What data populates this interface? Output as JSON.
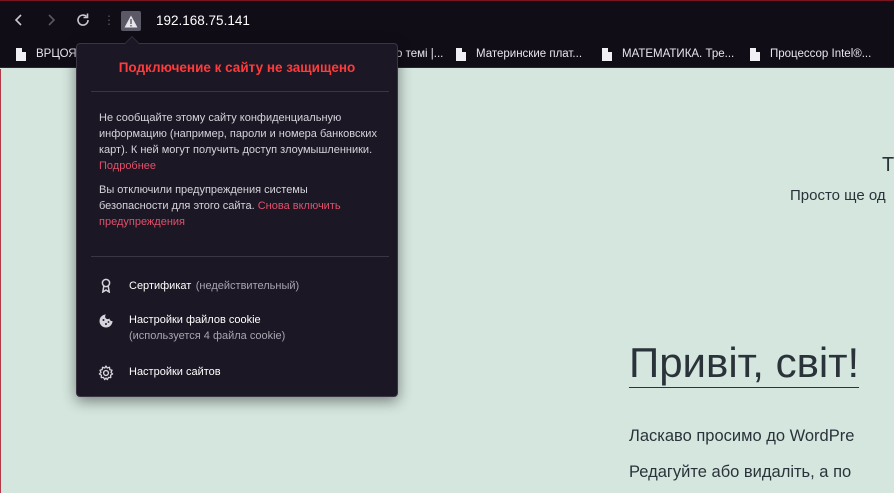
{
  "browser": {
    "address": "192.168.75.141",
    "bookmarks": [
      {
        "label": "ВРЦОЯ"
      },
      {
        "label": "о темі |..."
      },
      {
        "label": "Материнские плат..."
      },
      {
        "label": "МАТЕМАТИКА. Тре..."
      },
      {
        "label": "Процессор Intel®..."
      }
    ]
  },
  "site": {
    "title": "Т",
    "description": "Просто ще од",
    "post_title": "Привіт, світ!",
    "post_line1": "Ласкаво просимо до WordPre",
    "post_line2": "Редагуйте або видаліть, а по"
  },
  "popup": {
    "title": "Подключение к сайту не защищено",
    "warning_text": "Не сообщайте этому сайту конфиденциальную информацию (например, пароли и номера банковских карт). К ней могут получить доступ злоумышленники.",
    "warning_link": "Подробнее",
    "disabled_text": "Вы отключили предупреждения системы безопасности для этого сайта.",
    "disabled_link": "Снова включить предупреждения",
    "certificate_label": "Сертификат",
    "certificate_status": "(недействительный)",
    "cookies_label": "Настройки файлов cookie",
    "cookies_sub": "(используется 4 файла cookie)",
    "site_settings_label": "Настройки сайтов"
  },
  "colors": {
    "popup_title": "#ff3b3b",
    "link": "#e0506a",
    "page_bg": "#d4e6de",
    "chrome_bg": "#100d17"
  }
}
